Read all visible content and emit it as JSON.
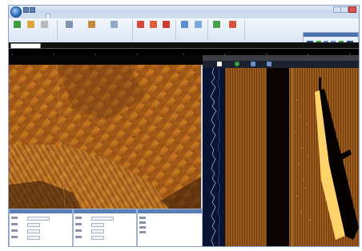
{
  "app": {
    "title": "",
    "window_controls": [
      "minimize-icon",
      "maximize-icon",
      "close-icon"
    ]
  },
  "ribbon": {
    "tabs": [
      {
        "label": ""
      },
      {
        "label": ""
      },
      {
        "label": ""
      },
      {
        "label": ""
      },
      {
        "label": ""
      },
      {
        "label": ""
      }
    ],
    "active_tab_index": 1,
    "groups": [
      {
        "label": "",
        "buttons": [
          {
            "label": "",
            "icon": "play-icon"
          },
          {
            "label": "",
            "icon": "folder-icon"
          },
          {
            "label": "",
            "icon": "stop-icon"
          }
        ]
      },
      {
        "label": "",
        "buttons": [
          {
            "label": "",
            "icon": "settings-icon"
          },
          {
            "label": "",
            "icon": "calibrate-icon"
          },
          {
            "label": "",
            "icon": "measure-icon"
          }
        ]
      },
      {
        "label": "",
        "buttons": [
          {
            "label": "",
            "icon": "target-red-icon"
          },
          {
            "label": "",
            "icon": "target-red-icon"
          },
          {
            "label": "",
            "icon": "target-red-icon"
          }
        ]
      },
      {
        "label": "",
        "buttons": [
          {
            "label": "",
            "icon": "grid-icon"
          },
          {
            "label": "",
            "icon": "layers-icon"
          }
        ]
      },
      {
        "label": "",
        "buttons": [
          {
            "label": "",
            "icon": "chart-icon"
          },
          {
            "label": "",
            "icon": "star-icon"
          }
        ]
      }
    ],
    "scroll_panel_title": ""
  },
  "timebar": {
    "time_value": "",
    "label": ""
  },
  "range_ruler": {
    "ticks": [
      "",
      "",
      "",
      "",
      "",
      "",
      "",
      "",
      ""
    ]
  },
  "colors": {
    "sonar_amber": "#c8781f",
    "sonar_dark": "#1a0d04",
    "ribbon_blue": "#4b73ad",
    "scale_blue": "#2a58c8",
    "trace_bg": "#0b1333",
    "trace_line": "#c9d6ff"
  },
  "right_pane": {
    "title": "",
    "toolbar_icons": [
      "stop-icon",
      "play-icon",
      "pause-icon",
      "record-icon"
    ]
  },
  "bottom_panels": [
    {
      "title": ""
    },
    {
      "title": ""
    },
    {
      "title": ""
    }
  ]
}
